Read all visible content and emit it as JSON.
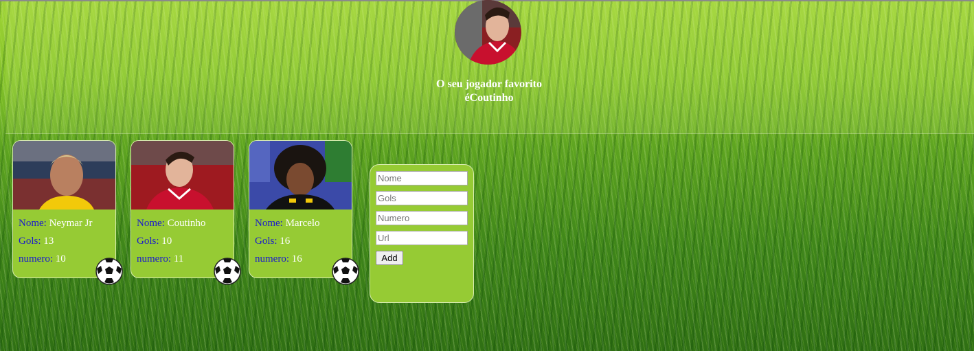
{
  "header": {
    "favorite_text_prefix": "O seu jogador favorito",
    "favorite_text_line2": "éCoutinho"
  },
  "players": [
    {
      "nome_label": "Nome:",
      "nome": "Neymar Jr",
      "gols_label": "Gols:",
      "gols": "13",
      "numero_label": "numero:",
      "numero": "10"
    },
    {
      "nome_label": "Nome:",
      "nome": "Coutinho",
      "gols_label": "Gols:",
      "gols": "10",
      "numero_label": "numero:",
      "numero": "11"
    },
    {
      "nome_label": "Nome:",
      "nome": "Marcelo",
      "gols_label": "Gols:",
      "gols": "16",
      "numero_label": "numero:",
      "numero": "16"
    }
  ],
  "form": {
    "nome_placeholder": "Nome",
    "gols_placeholder": "Gols",
    "numero_placeholder": "Numero",
    "url_placeholder": "Url",
    "add_label": "Add"
  },
  "colors": {
    "card_bg": "#96cb34",
    "label_blue": "#1a1acc",
    "value_white": "#ffffff"
  },
  "icons": [
    "soccer-ball-icon"
  ]
}
